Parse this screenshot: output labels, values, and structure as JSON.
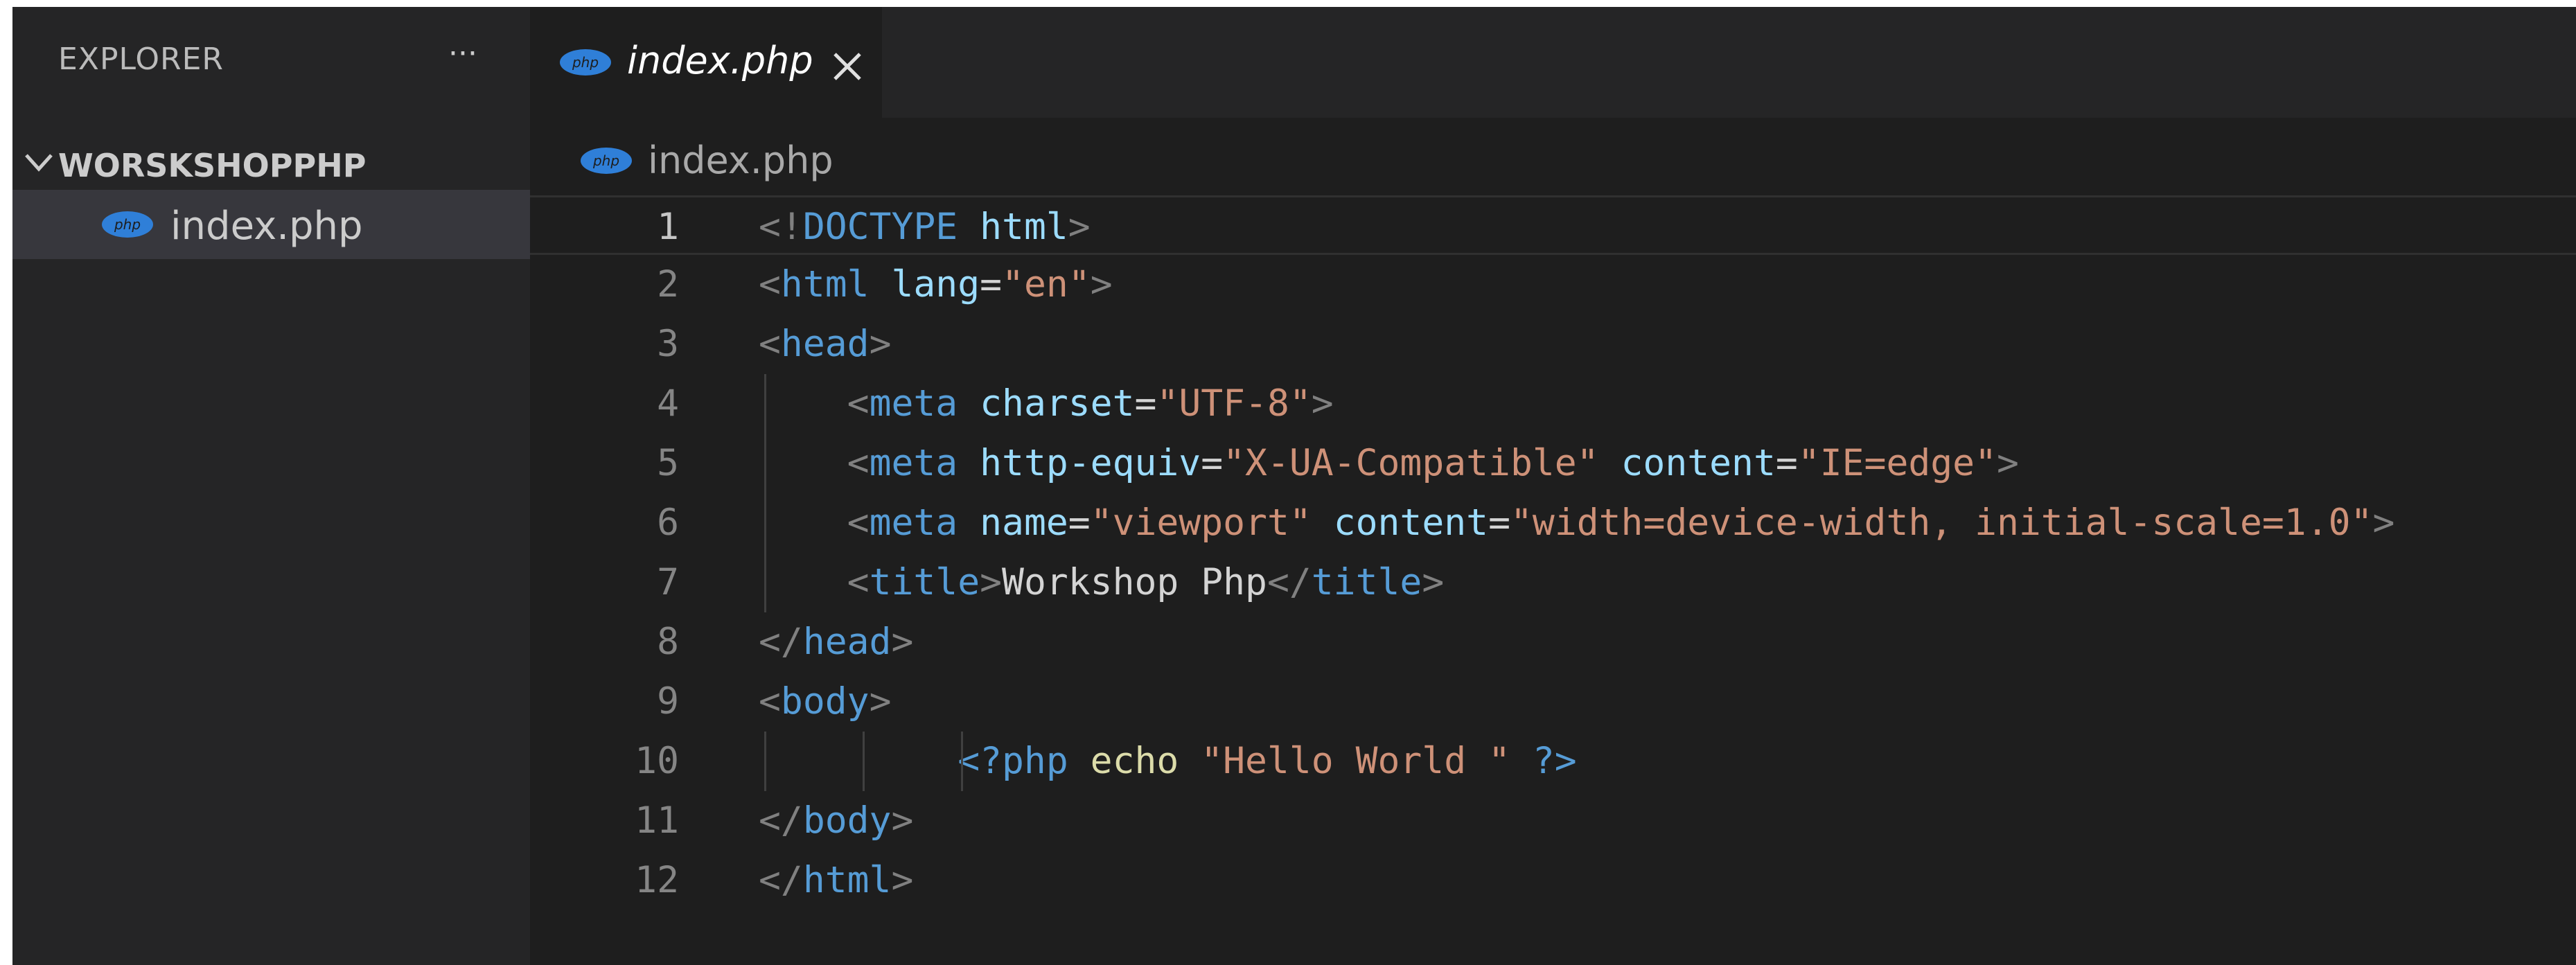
{
  "sidebar": {
    "title": "EXPLORER",
    "more_label": "···",
    "folder": "WORSKSHOPPHP",
    "file": "index.php"
  },
  "tab": {
    "label": "index.php"
  },
  "breadcrumb": {
    "label": "index.php"
  },
  "php_icon_text": "php",
  "colors": {
    "tag": "#569cd6",
    "attribute": "#9cdcfe",
    "string": "#ce9178",
    "bracket": "#808080",
    "function": "#dcdcaa",
    "text": "#d4d4d4",
    "php_icon": "#2f7fd8"
  },
  "code_lines": [
    {
      "n": "1",
      "tokens": [
        [
          "br",
          "<!"
        ],
        [
          "kw",
          "DOCTYPE"
        ],
        [
          "txt",
          " "
        ],
        [
          "attr",
          "html"
        ],
        [
          "br",
          ">"
        ]
      ]
    },
    {
      "n": "2",
      "tokens": [
        [
          "br",
          "<"
        ],
        [
          "kw",
          "html"
        ],
        [
          "txt",
          " "
        ],
        [
          "attr",
          "lang"
        ],
        [
          "txt",
          "="
        ],
        [
          "str",
          "\"en\""
        ],
        [
          "br",
          ">"
        ]
      ]
    },
    {
      "n": "3",
      "tokens": [
        [
          "br",
          "<"
        ],
        [
          "kw",
          "head"
        ],
        [
          "br",
          ">"
        ]
      ]
    },
    {
      "n": "4",
      "tokens": [
        [
          "txt",
          "    "
        ],
        [
          "br",
          "<"
        ],
        [
          "kw",
          "meta"
        ],
        [
          "txt",
          " "
        ],
        [
          "attr",
          "charset"
        ],
        [
          "txt",
          "="
        ],
        [
          "str",
          "\"UTF-8\""
        ],
        [
          "br",
          ">"
        ]
      ]
    },
    {
      "n": "5",
      "tokens": [
        [
          "txt",
          "    "
        ],
        [
          "br",
          "<"
        ],
        [
          "kw",
          "meta"
        ],
        [
          "txt",
          " "
        ],
        [
          "attr",
          "http-equiv"
        ],
        [
          "txt",
          "="
        ],
        [
          "str",
          "\"X-UA-Compatible\""
        ],
        [
          "txt",
          " "
        ],
        [
          "attr",
          "content"
        ],
        [
          "txt",
          "="
        ],
        [
          "str",
          "\"IE=edge\""
        ],
        [
          "br",
          ">"
        ]
      ]
    },
    {
      "n": "6",
      "tokens": [
        [
          "txt",
          "    "
        ],
        [
          "br",
          "<"
        ],
        [
          "kw",
          "meta"
        ],
        [
          "txt",
          " "
        ],
        [
          "attr",
          "name"
        ],
        [
          "txt",
          "="
        ],
        [
          "str",
          "\"viewport\""
        ],
        [
          "txt",
          " "
        ],
        [
          "attr",
          "content"
        ],
        [
          "txt",
          "="
        ],
        [
          "str",
          "\"width=device-width, initial-scale=1.0\""
        ],
        [
          "br",
          ">"
        ]
      ]
    },
    {
      "n": "7",
      "tokens": [
        [
          "txt",
          "    "
        ],
        [
          "br",
          "<"
        ],
        [
          "kw",
          "title"
        ],
        [
          "br",
          ">"
        ],
        [
          "txt",
          "Workshop Php"
        ],
        [
          "br",
          "</"
        ],
        [
          "kw",
          "title"
        ],
        [
          "br",
          ">"
        ]
      ]
    },
    {
      "n": "8",
      "tokens": [
        [
          "br",
          "</"
        ],
        [
          "kw",
          "head"
        ],
        [
          "br",
          ">"
        ]
      ]
    },
    {
      "n": "9",
      "tokens": [
        [
          "br",
          "<"
        ],
        [
          "kw",
          "body"
        ],
        [
          "br",
          ">"
        ]
      ]
    },
    {
      "n": "10",
      "tokens": [
        [
          "txt",
          "         "
        ],
        [
          "kw",
          "<?php"
        ],
        [
          "txt",
          " "
        ],
        [
          "fn",
          "echo"
        ],
        [
          "txt",
          " "
        ],
        [
          "str",
          "\"Hello World \""
        ],
        [
          "txt",
          " "
        ],
        [
          "kw",
          "?>"
        ]
      ]
    },
    {
      "n": "11",
      "tokens": [
        [
          "br",
          "</"
        ],
        [
          "kw",
          "body"
        ],
        [
          "br",
          ">"
        ]
      ]
    },
    {
      "n": "12",
      "tokens": [
        [
          "br",
          "</"
        ],
        [
          "kw",
          "html"
        ],
        [
          "br",
          ">"
        ]
      ]
    }
  ]
}
